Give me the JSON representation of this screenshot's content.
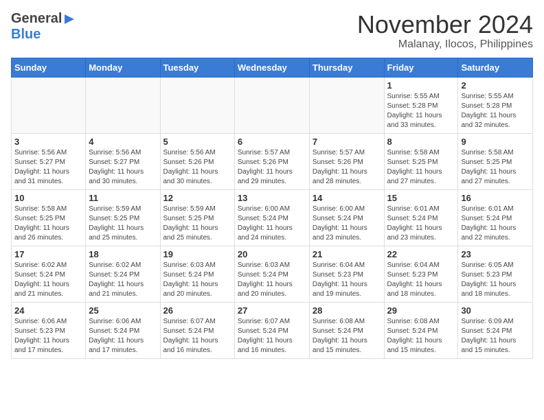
{
  "header": {
    "logo_general": "General",
    "logo_blue": "Blue",
    "month_year": "November 2024",
    "location": "Malanay, Ilocos, Philippines"
  },
  "calendar": {
    "days_of_week": [
      "Sunday",
      "Monday",
      "Tuesday",
      "Wednesday",
      "Thursday",
      "Friday",
      "Saturday"
    ],
    "weeks": [
      [
        {
          "day": "",
          "info": ""
        },
        {
          "day": "",
          "info": ""
        },
        {
          "day": "",
          "info": ""
        },
        {
          "day": "",
          "info": ""
        },
        {
          "day": "",
          "info": ""
        },
        {
          "day": "1",
          "info": "Sunrise: 5:55 AM\nSunset: 5:28 PM\nDaylight: 11 hours\nand 33 minutes."
        },
        {
          "day": "2",
          "info": "Sunrise: 5:55 AM\nSunset: 5:28 PM\nDaylight: 11 hours\nand 32 minutes."
        }
      ],
      [
        {
          "day": "3",
          "info": "Sunrise: 5:56 AM\nSunset: 5:27 PM\nDaylight: 11 hours\nand 31 minutes."
        },
        {
          "day": "4",
          "info": "Sunrise: 5:56 AM\nSunset: 5:27 PM\nDaylight: 11 hours\nand 30 minutes."
        },
        {
          "day": "5",
          "info": "Sunrise: 5:56 AM\nSunset: 5:26 PM\nDaylight: 11 hours\nand 30 minutes."
        },
        {
          "day": "6",
          "info": "Sunrise: 5:57 AM\nSunset: 5:26 PM\nDaylight: 11 hours\nand 29 minutes."
        },
        {
          "day": "7",
          "info": "Sunrise: 5:57 AM\nSunset: 5:26 PM\nDaylight: 11 hours\nand 28 minutes."
        },
        {
          "day": "8",
          "info": "Sunrise: 5:58 AM\nSunset: 5:25 PM\nDaylight: 11 hours\nand 27 minutes."
        },
        {
          "day": "9",
          "info": "Sunrise: 5:58 AM\nSunset: 5:25 PM\nDaylight: 11 hours\nand 27 minutes."
        }
      ],
      [
        {
          "day": "10",
          "info": "Sunrise: 5:58 AM\nSunset: 5:25 PM\nDaylight: 11 hours\nand 26 minutes."
        },
        {
          "day": "11",
          "info": "Sunrise: 5:59 AM\nSunset: 5:25 PM\nDaylight: 11 hours\nand 25 minutes."
        },
        {
          "day": "12",
          "info": "Sunrise: 5:59 AM\nSunset: 5:25 PM\nDaylight: 11 hours\nand 25 minutes."
        },
        {
          "day": "13",
          "info": "Sunrise: 6:00 AM\nSunset: 5:24 PM\nDaylight: 11 hours\nand 24 minutes."
        },
        {
          "day": "14",
          "info": "Sunrise: 6:00 AM\nSunset: 5:24 PM\nDaylight: 11 hours\nand 23 minutes."
        },
        {
          "day": "15",
          "info": "Sunrise: 6:01 AM\nSunset: 5:24 PM\nDaylight: 11 hours\nand 23 minutes."
        },
        {
          "day": "16",
          "info": "Sunrise: 6:01 AM\nSunset: 5:24 PM\nDaylight: 11 hours\nand 22 minutes."
        }
      ],
      [
        {
          "day": "17",
          "info": "Sunrise: 6:02 AM\nSunset: 5:24 PM\nDaylight: 11 hours\nand 21 minutes."
        },
        {
          "day": "18",
          "info": "Sunrise: 6:02 AM\nSunset: 5:24 PM\nDaylight: 11 hours\nand 21 minutes."
        },
        {
          "day": "19",
          "info": "Sunrise: 6:03 AM\nSunset: 5:24 PM\nDaylight: 11 hours\nand 20 minutes."
        },
        {
          "day": "20",
          "info": "Sunrise: 6:03 AM\nSunset: 5:24 PM\nDaylight: 11 hours\nand 20 minutes."
        },
        {
          "day": "21",
          "info": "Sunrise: 6:04 AM\nSunset: 5:23 PM\nDaylight: 11 hours\nand 19 minutes."
        },
        {
          "day": "22",
          "info": "Sunrise: 6:04 AM\nSunset: 5:23 PM\nDaylight: 11 hours\nand 18 minutes."
        },
        {
          "day": "23",
          "info": "Sunrise: 6:05 AM\nSunset: 5:23 PM\nDaylight: 11 hours\nand 18 minutes."
        }
      ],
      [
        {
          "day": "24",
          "info": "Sunrise: 6:06 AM\nSunset: 5:23 PM\nDaylight: 11 hours\nand 17 minutes."
        },
        {
          "day": "25",
          "info": "Sunrise: 6:06 AM\nSunset: 5:24 PM\nDaylight: 11 hours\nand 17 minutes."
        },
        {
          "day": "26",
          "info": "Sunrise: 6:07 AM\nSunset: 5:24 PM\nDaylight: 11 hours\nand 16 minutes."
        },
        {
          "day": "27",
          "info": "Sunrise: 6:07 AM\nSunset: 5:24 PM\nDaylight: 11 hours\nand 16 minutes."
        },
        {
          "day": "28",
          "info": "Sunrise: 6:08 AM\nSunset: 5:24 PM\nDaylight: 11 hours\nand 15 minutes."
        },
        {
          "day": "29",
          "info": "Sunrise: 6:08 AM\nSunset: 5:24 PM\nDaylight: 11 hours\nand 15 minutes."
        },
        {
          "day": "30",
          "info": "Sunrise: 6:09 AM\nSunset: 5:24 PM\nDaylight: 11 hours\nand 15 minutes."
        }
      ]
    ]
  }
}
